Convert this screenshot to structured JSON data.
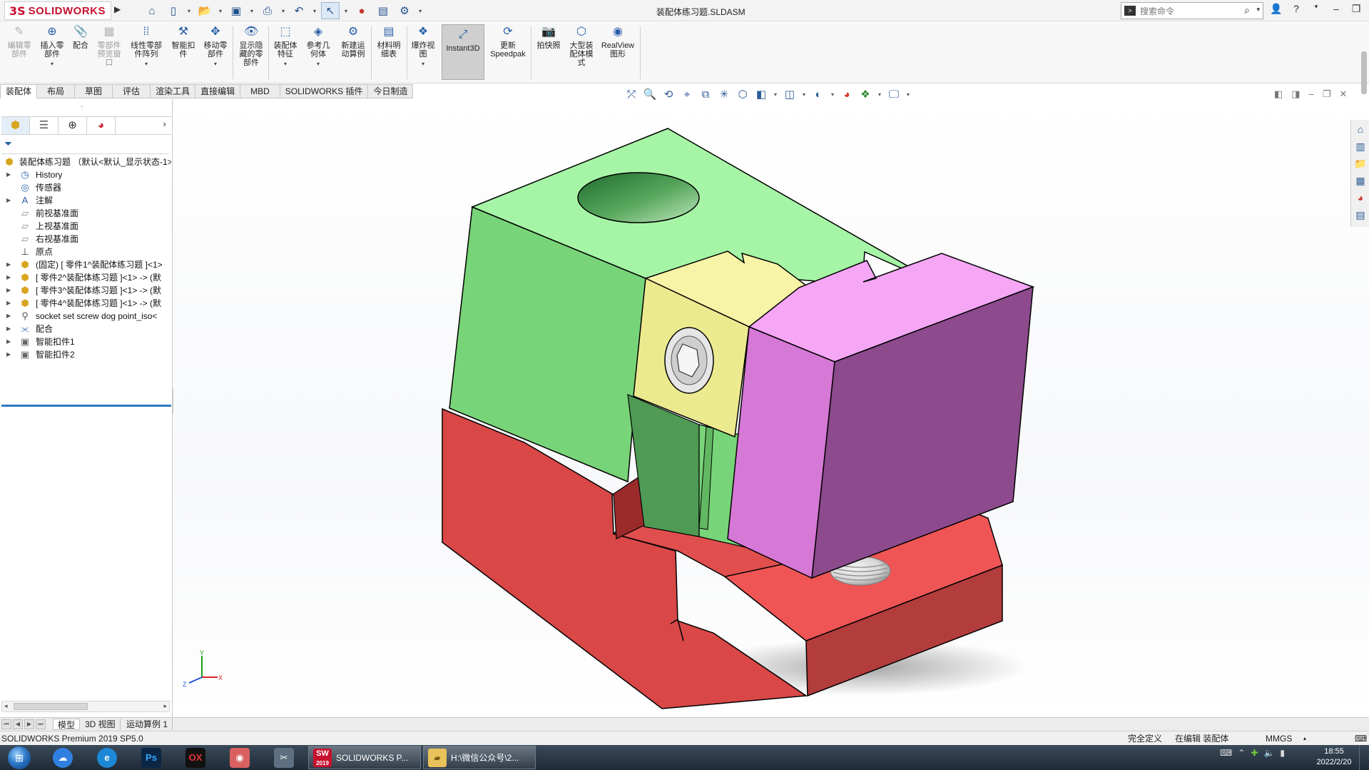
{
  "app": {
    "brand": "SOLIDWORKS",
    "brand_prefix": "3S",
    "document_title": "装配体练习题.SLDASM",
    "search_placeholder": "搜索命令"
  },
  "ribbon": {
    "buttons": [
      {
        "label": "编辑零\n部件",
        "icon": "edit-component-icon"
      },
      {
        "label": "插入零\n部件",
        "icon": "insert-component-icon"
      },
      {
        "label": "配合",
        "icon": "mate-icon"
      },
      {
        "label": "零部件\n预览窗\n口",
        "icon": "preview-window-icon"
      },
      {
        "label": "线性零部\n件阵列",
        "icon": "linear-pattern-icon"
      },
      {
        "label": "智能扣\n件",
        "icon": "smart-fasteners-icon"
      },
      {
        "label": "移动零\n部件",
        "icon": "move-component-icon"
      },
      {
        "label": "显示隐\n藏的零\n部件",
        "icon": "show-hidden-icon"
      },
      {
        "label": "装配体\n特征",
        "icon": "assembly-features-icon"
      },
      {
        "label": "参考几\n何体",
        "icon": "reference-geometry-icon"
      },
      {
        "label": "新建运\n动算例",
        "icon": "motion-study-icon"
      },
      {
        "label": "材料明\n细表",
        "icon": "bom-icon"
      },
      {
        "label": "爆炸视\n图",
        "icon": "exploded-view-icon"
      },
      {
        "label": "Instant3D",
        "icon": "instant3d-icon"
      },
      {
        "label": "更新\nSpeedpak",
        "icon": "speedpak-icon"
      },
      {
        "label": "拍快照",
        "icon": "snapshot-icon"
      },
      {
        "label": "大型装\n配体模\n式",
        "icon": "large-assembly-icon"
      },
      {
        "label": "RealView\n图形",
        "icon": "realview-icon"
      }
    ]
  },
  "tabs": [
    "装配体",
    "布局",
    "草图",
    "评估",
    "渲染工具",
    "直接编辑",
    "MBD",
    "SOLIDWORKS 插件",
    "今日制造"
  ],
  "tree": {
    "root": "装配体练习题 （默认<默认_显示状态-1>",
    "items": [
      {
        "label": "History",
        "icon": "history-icon"
      },
      {
        "label": "传感器",
        "icon": "sensor-icon"
      },
      {
        "label": "注解",
        "icon": "annotation-icon"
      },
      {
        "label": "前视基准面",
        "icon": "plane-icon"
      },
      {
        "label": "上视基准面",
        "icon": "plane-icon"
      },
      {
        "label": "右视基准面",
        "icon": "plane-icon"
      },
      {
        "label": "原点",
        "icon": "origin-icon"
      },
      {
        "label": "(固定) [ 零件1^装配体练习题 ]<1>",
        "icon": "part-icon"
      },
      {
        "label": "[ 零件2^装配体练习题 ]<1> -> (默",
        "icon": "part-icon"
      },
      {
        "label": "[ 零件3^装配体练习题 ]<1> -> (默",
        "icon": "part-icon"
      },
      {
        "label": "[ 零件4^装配体练习题 ]<1> -> (默",
        "icon": "part-icon"
      },
      {
        "label": "socket set screw dog point_iso<",
        "icon": "screw-icon"
      },
      {
        "label": "配合",
        "icon": "mates-icon"
      },
      {
        "label": "智能扣件1",
        "icon": "smart-fastener-icon"
      },
      {
        "label": "智能扣件2",
        "icon": "smart-fastener-icon"
      }
    ]
  },
  "triad": {
    "x": "X",
    "y": "Y",
    "z": "Z"
  },
  "bottom_tabs": [
    "模型",
    "3D 视图",
    "运动算例 1"
  ],
  "status": {
    "product": "SOLIDWORKS Premium 2019 SP5.0",
    "definition": "完全定义",
    "editing": "在编辑 装配体",
    "units": "MMGS"
  },
  "taskbar": {
    "windows": [
      {
        "label": "SOLIDWORKS P...",
        "badge": "SW",
        "year": "2019"
      },
      {
        "label": "H:\\微信公众号\\2..."
      }
    ],
    "apps": [
      "Ps",
      "OX"
    ],
    "time": "18:55",
    "date": "2022/2/20"
  },
  "colors": {
    "green": "#80d880",
    "green_top": "#a8f5a8",
    "red": "#d64545",
    "yellow": "#f1ef95",
    "magenta": "#d97bd9",
    "purple": "#8f4a8f",
    "pink_top": "#f7a9f7"
  }
}
